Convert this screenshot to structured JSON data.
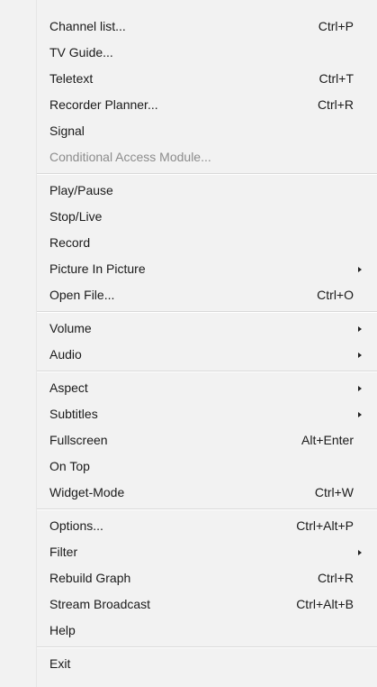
{
  "menu": {
    "groups": [
      {
        "items": [
          {
            "label": "Channel list...",
            "shortcut": "Ctrl+P",
            "submenu": false,
            "disabled": false
          },
          {
            "label": "TV Guide...",
            "shortcut": "",
            "submenu": false,
            "disabled": false
          },
          {
            "label": "Teletext",
            "shortcut": "Ctrl+T",
            "submenu": false,
            "disabled": false
          },
          {
            "label": "Recorder Planner...",
            "shortcut": "Ctrl+R",
            "submenu": false,
            "disabled": false
          },
          {
            "label": "Signal",
            "shortcut": "",
            "submenu": false,
            "disabled": false
          },
          {
            "label": "Conditional Access Module...",
            "shortcut": "",
            "submenu": false,
            "disabled": true
          }
        ]
      },
      {
        "items": [
          {
            "label": "Play/Pause",
            "shortcut": "",
            "submenu": false,
            "disabled": false
          },
          {
            "label": "Stop/Live",
            "shortcut": "",
            "submenu": false,
            "disabled": false
          },
          {
            "label": "Record",
            "shortcut": "",
            "submenu": false,
            "disabled": false
          },
          {
            "label": "Picture In Picture",
            "shortcut": "",
            "submenu": true,
            "disabled": false
          },
          {
            "label": "Open File...",
            "shortcut": "Ctrl+O",
            "submenu": false,
            "disabled": false
          }
        ]
      },
      {
        "items": [
          {
            "label": "Volume",
            "shortcut": "",
            "submenu": true,
            "disabled": false
          },
          {
            "label": "Audio",
            "shortcut": "",
            "submenu": true,
            "disabled": false
          }
        ]
      },
      {
        "items": [
          {
            "label": "Aspect",
            "shortcut": "",
            "submenu": true,
            "disabled": false
          },
          {
            "label": "Subtitles",
            "shortcut": "",
            "submenu": true,
            "disabled": false
          },
          {
            "label": "Fullscreen",
            "shortcut": "Alt+Enter",
            "submenu": false,
            "disabled": false
          },
          {
            "label": "On Top",
            "shortcut": "",
            "submenu": false,
            "disabled": false
          },
          {
            "label": "Widget-Mode",
            "shortcut": "Ctrl+W",
            "submenu": false,
            "disabled": false
          }
        ]
      },
      {
        "items": [
          {
            "label": "Options...",
            "shortcut": "Ctrl+Alt+P",
            "submenu": false,
            "disabled": false
          },
          {
            "label": "Filter",
            "shortcut": "",
            "submenu": true,
            "disabled": false
          },
          {
            "label": "Rebuild Graph",
            "shortcut": "Ctrl+R",
            "submenu": false,
            "disabled": false
          },
          {
            "label": "Stream Broadcast",
            "shortcut": "Ctrl+Alt+B",
            "submenu": false,
            "disabled": false
          },
          {
            "label": "Help",
            "shortcut": "",
            "submenu": false,
            "disabled": false
          }
        ]
      },
      {
        "items": [
          {
            "label": "Exit",
            "shortcut": "",
            "submenu": false,
            "disabled": false
          }
        ]
      }
    ]
  },
  "colors": {
    "menu_background": "#f2f2f2",
    "text": "#1a1a1a",
    "disabled_text": "#8c8c8c",
    "separator": "#d9d9d9"
  }
}
